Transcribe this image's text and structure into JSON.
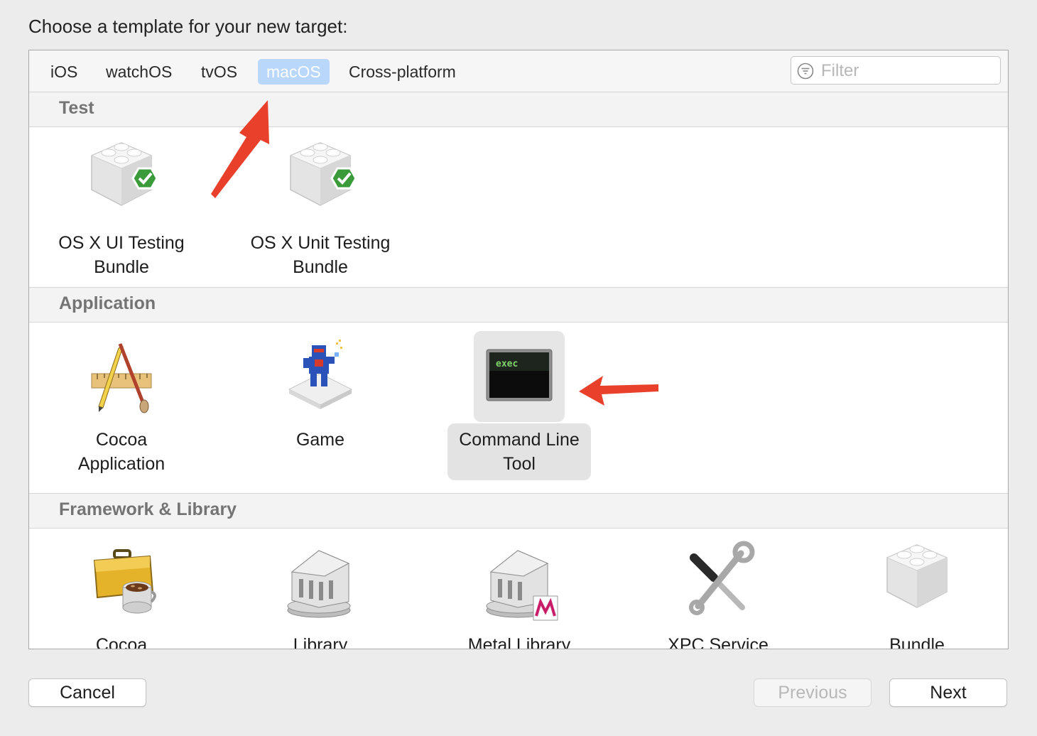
{
  "dialog": {
    "title": "Choose a template for your new target:"
  },
  "tabs": [
    {
      "label": "iOS",
      "selected": false
    },
    {
      "label": "watchOS",
      "selected": false
    },
    {
      "label": "tvOS",
      "selected": false
    },
    {
      "label": "macOS",
      "selected": true
    },
    {
      "label": "Cross-platform",
      "selected": false
    }
  ],
  "filter": {
    "placeholder": "Filter",
    "value": ""
  },
  "sections": [
    {
      "title": "Test",
      "items": [
        {
          "label": "OS X UI Testing\nBundle",
          "icon": "test-bundle-icon"
        },
        {
          "label": "OS X Unit Testing\nBundle",
          "icon": "test-bundle-icon"
        }
      ]
    },
    {
      "title": "Application",
      "items": [
        {
          "label": "Cocoa\nApplication",
          "icon": "cocoa-app-icon"
        },
        {
          "label": "Game",
          "icon": "game-icon"
        },
        {
          "label": "Command Line\nTool",
          "icon": "terminal-icon",
          "selected": true,
          "icon_text": "exec"
        }
      ]
    },
    {
      "title": "Framework & Library",
      "items": [
        {
          "label": "Cocoa",
          "icon": "toolbox-icon"
        },
        {
          "label": "Library",
          "icon": "library-icon"
        },
        {
          "label": "Metal Library",
          "icon": "metal-library-icon"
        },
        {
          "label": "XPC Service",
          "icon": "tools-icon"
        },
        {
          "label": "Bundle",
          "icon": "bundle-icon"
        }
      ]
    }
  ],
  "buttons": {
    "cancel": "Cancel",
    "previous": "Previous",
    "next": "Next"
  },
  "colors": {
    "selected_tab": "#b9d6fb",
    "annotation_arrow": "#e8402a",
    "check_badge": "#3b9a3a"
  }
}
